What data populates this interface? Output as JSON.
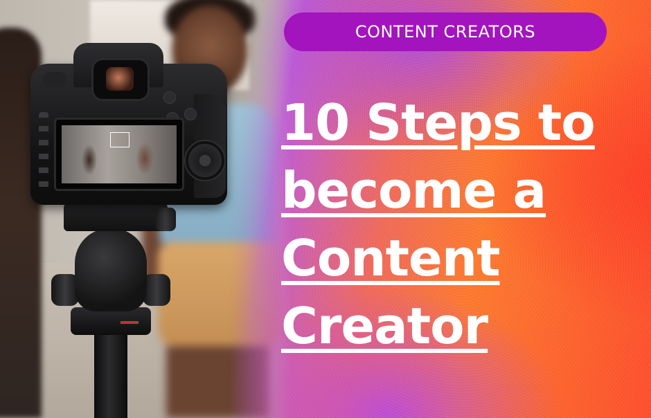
{
  "category": {
    "label": "CONTENT CREATORS",
    "color": "#a314bf"
  },
  "headline": {
    "lines": [
      "10 Steps to",
      "become a",
      "Content",
      "Creator"
    ],
    "color": "#ffffff"
  },
  "colors": {
    "gradient_purple": "#c05bd8",
    "gradient_orange": "#ff7a2e",
    "gradient_red": "#ff3d27"
  },
  "image": {
    "subject": "camera-on-tripod-photo"
  }
}
